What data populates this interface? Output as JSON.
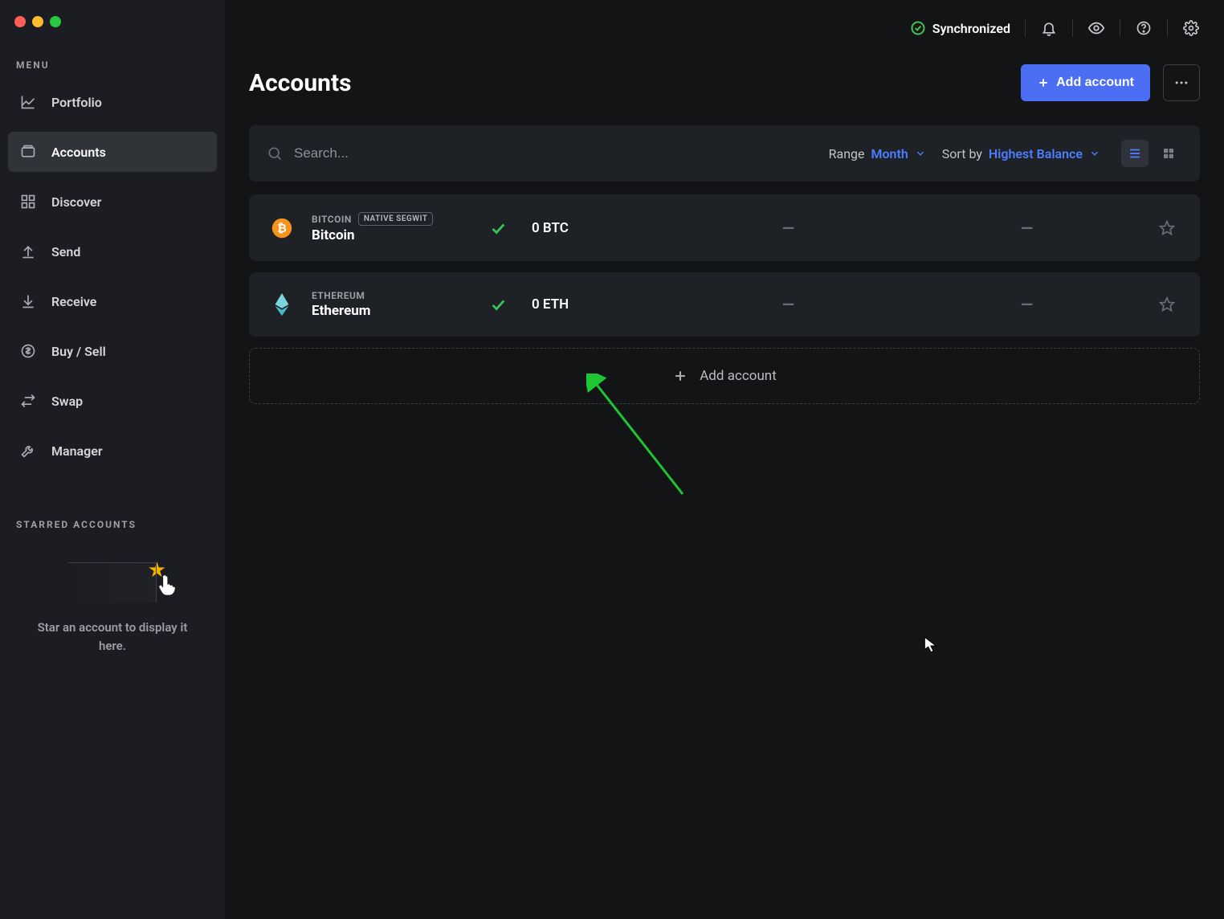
{
  "sidebar": {
    "menu_label": "MENU",
    "items": [
      {
        "label": "Portfolio"
      },
      {
        "label": "Accounts"
      },
      {
        "label": "Discover"
      },
      {
        "label": "Send"
      },
      {
        "label": "Receive"
      },
      {
        "label": "Buy / Sell"
      },
      {
        "label": "Swap"
      },
      {
        "label": "Manager"
      }
    ],
    "starred_label": "STARRED ACCOUNTS",
    "starred_hint": "Star an account to display it here."
  },
  "topbar": {
    "sync_label": "Synchronized"
  },
  "page": {
    "title": "Accounts",
    "add_account": "Add account"
  },
  "filters": {
    "search_placeholder": "Search...",
    "range_label": "Range",
    "range_value": "Month",
    "sort_label": "Sort by",
    "sort_value": "Highest Balance"
  },
  "accounts": [
    {
      "asset": "BITCOIN",
      "badge": "NATIVE SEGWIT",
      "name": "Bitcoin",
      "balance": "0 BTC",
      "icon_color": "#f7931a"
    },
    {
      "asset": "ETHEREUM",
      "badge": "",
      "name": "Ethereum",
      "balance": "0 ETH",
      "icon_color": "#62d0d7"
    }
  ],
  "add_row_label": "Add account"
}
